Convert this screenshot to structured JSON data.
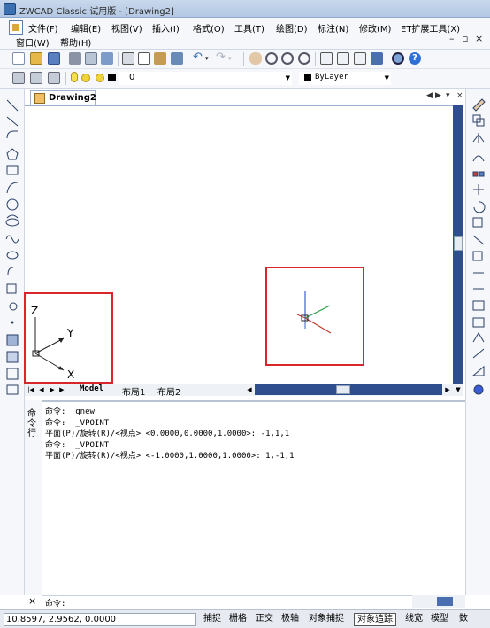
{
  "window": {
    "title": "ZWCAD Classic 试用版 - [Drawing2]"
  },
  "menu": {
    "items": [
      "文件(F)",
      "编辑(E)",
      "视图(V)",
      "插入(I)",
      "格式(O)",
      "工具(T)",
      "绘图(D)",
      "标注(N)",
      "修改(M)",
      "ET扩展工具(X)"
    ],
    "items_row2": [
      "窗口(W)",
      "帮助(H)"
    ],
    "window_controls": [
      "–",
      "▫",
      "×"
    ]
  },
  "layer": {
    "current": "0"
  },
  "color": {
    "current": "ByLayer"
  },
  "tabs": {
    "document": "Drawing2",
    "layouts": [
      "Model",
      "布局1",
      "布局2"
    ]
  },
  "ucs_icon": {
    "labels": [
      "Z",
      "Y",
      "X"
    ]
  },
  "command": {
    "side_label": "命令行",
    "history": [
      "命令: _qnew",
      "命令: '_VPOINT",
      "平面(P)/旋转(R)/<视点> <0.0000,0.0000,1.0000>: -1,1,1",
      "命令: '_VPOINT",
      "平面(P)/旋转(R)/<视点> <-1.0000,1.0000,1.0000>: 1,-1,1"
    ],
    "prompt": "命令:"
  },
  "status": {
    "coords": "10.8597, 2.9562, 0.0000",
    "buttons": [
      "捕捉",
      "栅格",
      "正交",
      "极轴",
      "对象捕捉",
      "对象追踪",
      "线宽",
      "模型",
      "数"
    ]
  },
  "colors": {
    "accent": "#2f4e8e",
    "highlight": "#d8262c",
    "axis_red": "#c0392b",
    "axis_green": "#27a045",
    "axis_blue": "#3b5bd6"
  }
}
